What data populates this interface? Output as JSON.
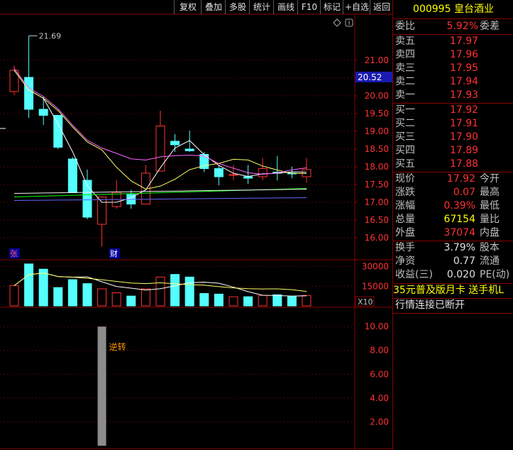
{
  "toolbar": {
    "buttons": [
      "复权",
      "叠加",
      "多股",
      "统计",
      "画线",
      "F10",
      "标记",
      "+自选",
      "返回"
    ]
  },
  "chart": {
    "price_axis": [
      "21.00",
      "20.50",
      "20.00",
      "19.50",
      "19.00",
      "18.50",
      "18.00",
      "17.50",
      "17.00",
      "16.50",
      "16.00"
    ],
    "current_price_tag": "20.52",
    "high_label": "21.69",
    "markers": {
      "zhang": "张",
      "cai": "财"
    },
    "volume_axis": [
      "30000",
      "15000"
    ],
    "volume_unit": "X10",
    "indicator_axis": [
      "10.00",
      "8.00",
      "6.00",
      "4.00",
      "2.00"
    ],
    "indicator_label": "逆转",
    "colors": {
      "up": "#ff3232",
      "down": "#54ffff",
      "ma5": "#ffffff",
      "ma10": "#ffff66",
      "ma20": "#ff66ff",
      "ma30": "#00ff00",
      "ma60": "#6666ff",
      "ma_long": "#f0f0f0"
    }
  },
  "chart_data": {
    "type": "candlestick",
    "candles": [
      {
        "o": 20.12,
        "h": 20.85,
        "l": 20.02,
        "c": 20.72
      },
      {
        "o": 20.52,
        "h": 21.69,
        "l": 19.38,
        "c": 19.62
      },
      {
        "o": 19.62,
        "h": 19.98,
        "l": 19.18,
        "c": 19.45
      },
      {
        "o": 19.45,
        "h": 19.45,
        "l": 18.5,
        "c": 18.55
      },
      {
        "o": 18.22,
        "h": 18.27,
        "l": 17.27,
        "c": 17.27
      },
      {
        "o": 17.62,
        "h": 17.92,
        "l": 16.52,
        "c": 16.58
      },
      {
        "o": 16.38,
        "h": 17.15,
        "l": 15.75,
        "c": 17.15
      },
      {
        "o": 16.88,
        "h": 17.62,
        "l": 16.82,
        "c": 17.28
      },
      {
        "o": 17.22,
        "h": 17.35,
        "l": 16.82,
        "c": 16.95
      },
      {
        "o": 16.95,
        "h": 18.05,
        "l": 16.95,
        "c": 17.82
      },
      {
        "o": 17.88,
        "h": 19.58,
        "l": 17.88,
        "c": 19.15
      },
      {
        "o": 18.72,
        "h": 18.92,
        "l": 18.42,
        "c": 18.62
      },
      {
        "o": 18.5,
        "h": 19.02,
        "l": 18.42,
        "c": 18.45
      },
      {
        "o": 18.35,
        "h": 18.42,
        "l": 17.85,
        "c": 17.95
      },
      {
        "o": 17.95,
        "h": 18.05,
        "l": 17.48,
        "c": 17.72
      },
      {
        "o": 17.78,
        "h": 18.05,
        "l": 17.62,
        "c": 17.78
      },
      {
        "o": 17.72,
        "h": 18.05,
        "l": 17.52,
        "c": 17.68
      },
      {
        "o": 17.72,
        "h": 18.25,
        "l": 17.62,
        "c": 17.95
      },
      {
        "o": 17.85,
        "h": 18.3,
        "l": 17.62,
        "c": 17.82
      },
      {
        "o": 17.82,
        "h": 18.0,
        "l": 17.68,
        "c": 17.8
      },
      {
        "o": 17.72,
        "h": 18.25,
        "l": 17.55,
        "c": 17.92
      }
    ],
    "volumes": [
      15500,
      32000,
      28000,
      14000,
      20000,
      17000,
      13000,
      10000,
      7500,
      13000,
      22000,
      24000,
      22000,
      9500,
      9000,
      7000,
      7000,
      8000,
      8500,
      7000,
      8000
    ],
    "indicator_bar_value": 10.0,
    "ylim_price": [
      15.9,
      21.9
    ],
    "ylim_volume": [
      0,
      33000
    ],
    "ylim_indicator": [
      0,
      11.2
    ]
  },
  "quote": {
    "title": "000995 皇台酒业",
    "weibi": {
      "label": "委比",
      "value": "5.92%",
      "label2": "委差"
    },
    "asks": [
      {
        "label": "卖五",
        "price": "17.97"
      },
      {
        "label": "卖四",
        "price": "17.96"
      },
      {
        "label": "卖三",
        "price": "17.95"
      },
      {
        "label": "卖二",
        "price": "17.94"
      },
      {
        "label": "卖一",
        "price": "17.93"
      }
    ],
    "bids": [
      {
        "label": "买一",
        "price": "17.92"
      },
      {
        "label": "买二",
        "price": "17.91"
      },
      {
        "label": "买三",
        "price": "17.90"
      },
      {
        "label": "买四",
        "price": "17.89"
      },
      {
        "label": "买五",
        "price": "17.88"
      }
    ],
    "stats": [
      {
        "label": "现价",
        "value": "17.92",
        "label2": "今开",
        "color": "red"
      },
      {
        "label": "涨跌",
        "value": "0.07",
        "label2": "最高",
        "color": "red"
      },
      {
        "label": "涨幅",
        "value": "0.39%",
        "label2": "最低",
        "color": "red"
      },
      {
        "label": "总量",
        "value": "67154",
        "label2": "量比",
        "color": "yel"
      },
      {
        "label": "外盘",
        "value": "37074",
        "label2": "内盘",
        "color": "red"
      }
    ],
    "stats2": [
      {
        "label": "换手",
        "value": "3.79%",
        "label2": "股本"
      },
      {
        "label": "净资",
        "value": "0.77",
        "label2": "流通"
      },
      {
        "label": "收益(三)",
        "value": "0.020",
        "label2": "PE(动)"
      }
    ],
    "ad": "35元普及版月卡 送手机L",
    "status": "行情连接已断开"
  }
}
